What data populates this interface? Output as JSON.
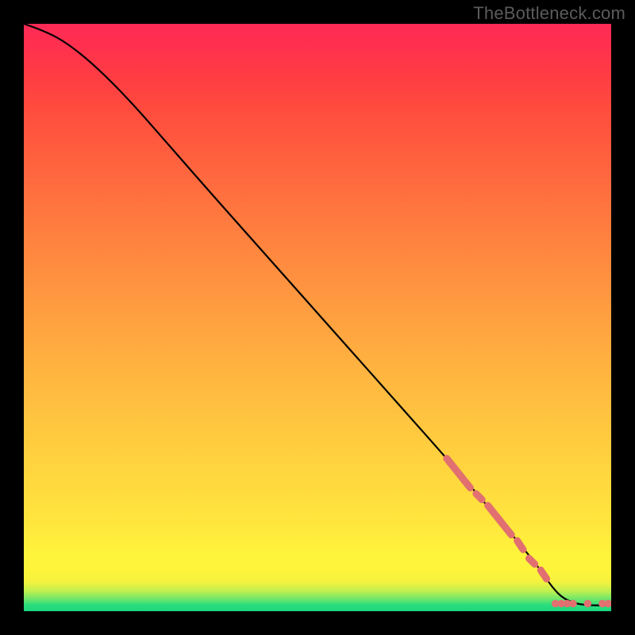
{
  "watermark": "TheBottleneck.com",
  "chart_data": {
    "type": "line",
    "title": "",
    "xlabel": "",
    "ylabel": "",
    "xlim": [
      0,
      100
    ],
    "ylim": [
      0,
      100
    ],
    "grid": false,
    "series": [
      {
        "name": "curve",
        "color": "#000000",
        "x": [
          0,
          3,
          7,
          12,
          18,
          25,
          32,
          40,
          48,
          56,
          64,
          72,
          78,
          84,
          88,
          90,
          92,
          95,
          100
        ],
        "y": [
          100,
          99,
          97,
          93,
          87,
          79,
          71,
          62,
          53,
          44,
          35,
          26,
          19,
          12,
          7,
          4,
          2,
          1,
          1
        ]
      }
    ],
    "highlight_segments": {
      "color": "#e27070",
      "stroke_width": 9,
      "segments": [
        {
          "x0": 72,
          "y0": 26,
          "x1": 76,
          "y1": 21
        },
        {
          "x0": 77,
          "y0": 20,
          "x1": 78,
          "y1": 19
        },
        {
          "x0": 79,
          "y0": 18,
          "x1": 83,
          "y1": 13
        },
        {
          "x0": 84,
          "y0": 12,
          "x1": 85,
          "y1": 10.5
        },
        {
          "x0": 86,
          "y0": 9,
          "x1": 87,
          "y1": 8
        },
        {
          "x0": 88,
          "y0": 7,
          "x1": 89,
          "y1": 5.5
        }
      ]
    },
    "highlight_dots": {
      "color": "#e27070",
      "radius": 4.8,
      "points": [
        {
          "x": 90.5,
          "y": 1.3
        },
        {
          "x": 91.5,
          "y": 1.3
        },
        {
          "x": 92.5,
          "y": 1.3
        },
        {
          "x": 93.5,
          "y": 1.3
        },
        {
          "x": 96,
          "y": 1.3
        },
        {
          "x": 98.5,
          "y": 1.3
        },
        {
          "x": 99.5,
          "y": 1.3
        }
      ]
    }
  }
}
